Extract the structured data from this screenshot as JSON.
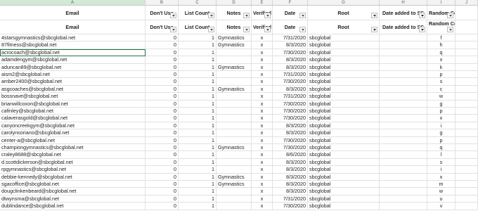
{
  "column_letters": [
    "A",
    "B",
    "C",
    "D",
    "E",
    "F",
    "G",
    "H",
    "I",
    "J"
  ],
  "header_row_1": [
    "Email",
    "Don't Use",
    "List Count",
    "Notes",
    "Verified",
    "Date",
    "Root",
    "Date added to SS",
    "Random Counter",
    ""
  ],
  "header_row_2": [
    "Email",
    "Don't Use",
    "List Count",
    "Notes",
    "Verified",
    "Date",
    "Root",
    "Date added to SS",
    "Random Counter",
    ""
  ],
  "rows": [
    [
      "4starsgymnastics@sbcglobal.net",
      "0",
      "1",
      "Gymnastics",
      "x",
      "7/31/2020",
      "sbcglobal",
      "",
      "f"
    ],
    [
      "87fitness@sbcglobal.net",
      "0",
      "1",
      "Gymnastics",
      "x",
      "8/3/2020",
      "sbcglobal",
      "",
      "h"
    ],
    [
      "acrocoach@sbcglobal.net",
      "0",
      "1",
      "",
      "x",
      "7/30/2020",
      "sbcglobal",
      "",
      "q"
    ],
    [
      "adamdengym@sbcglobal.net",
      "0",
      "1",
      "",
      "x",
      "8/3/2020",
      "sbcglobal",
      "",
      "x"
    ],
    [
      "aduncan89@sbcglobal.net",
      "0",
      "1",
      "Gymnastics",
      "x",
      "8/3/2020",
      "sbcglobal",
      "",
      "k"
    ],
    [
      "aism2@sbcglobal.net",
      "0",
      "1",
      "",
      "x",
      "7/31/2020",
      "sbcglobal",
      "",
      "p"
    ],
    [
      "amber2400@sbcglobal.net",
      "0",
      "1",
      "",
      "x",
      "7/30/2020",
      "sbcglobal",
      "",
      "s"
    ],
    [
      "asgcoaches@sbcglobal.net",
      "0",
      "1",
      "Gymnastics",
      "x",
      "8/3/2020",
      "sbcglobal",
      "",
      "c"
    ],
    [
      "bossnave@sbcglobal.net",
      "0",
      "1",
      "",
      "x",
      "7/31/2020",
      "sbcglobal",
      "",
      "w"
    ],
    [
      "brianwillcoxon@sbcglobal.net",
      "0",
      "1",
      "",
      "x",
      "7/30/2020",
      "sbcglobal",
      "",
      "g"
    ],
    [
      "cafinley@sbcglobal.net",
      "0",
      "1",
      "",
      "x",
      "7/30/2020",
      "sbcglobal",
      "",
      "p"
    ],
    [
      "calaverasgold@sbcglobal.net",
      "0",
      "1",
      "",
      "x",
      "7/30/2020",
      "sbcglobal",
      "",
      "x"
    ],
    [
      "canyoncreekgym@sbcglobal.net",
      "0",
      "1",
      "",
      "x",
      "8/3/2020",
      "sbcglobal",
      "",
      "i"
    ],
    [
      "carolynsoriano@sbcglobal.net",
      "0",
      "1",
      "",
      "x",
      "8/3/2020",
      "sbcglobal",
      "",
      "g"
    ],
    [
      "center-a@sbcglobal.net",
      "0",
      "1",
      "",
      "x",
      "7/30/2020",
      "sbcglobal",
      "",
      "p"
    ],
    [
      "championgymnastics@sbcglobal.net",
      "0",
      "1",
      "Gymnastics",
      "x",
      "7/30/2020",
      "sbcglobal",
      "",
      "q"
    ],
    [
      "craley8688@sbcglobal.net",
      "0",
      "1",
      "",
      "x",
      "8/6/2020",
      "sbcglobal",
      "",
      "l"
    ],
    [
      "d.scottdickerson@sbcglobal.net",
      "0",
      "1",
      "",
      "x",
      "8/3/2020",
      "sbcglobal",
      "",
      "s"
    ],
    [
      "rpgymnastics@sbcglobal.net",
      "0",
      "1",
      "",
      "x",
      "8/3/2020",
      "sbcglobal",
      "",
      "i"
    ],
    [
      "debbie-kennedy@sbcglobal.net",
      "0",
      "1",
      "Gymnastics",
      "x",
      "8/3/2020",
      "sbcglobal",
      "",
      "x"
    ],
    [
      "sgacoffice@sbcglobal.net",
      "0",
      "1",
      "Gymnastics",
      "x",
      "8/3/2020",
      "sbcglobal",
      "",
      "m"
    ],
    [
      "dougclinkenbeard@sbcglobal.net",
      "0",
      "1",
      "",
      "x",
      "8/3/2020",
      "sbcglobal",
      "",
      "w"
    ],
    [
      "dtwynsma@sbcglobal.net",
      "0",
      "1",
      "",
      "x",
      "7/31/2020",
      "sbcglobal",
      "",
      "u"
    ],
    [
      "dublindance@sbcglobal.net",
      "0",
      "1",
      "",
      "x",
      "7/30/2020",
      "sbcglobal",
      "",
      "v"
    ]
  ],
  "selected_cell": "A3",
  "accent_color": "#217346"
}
